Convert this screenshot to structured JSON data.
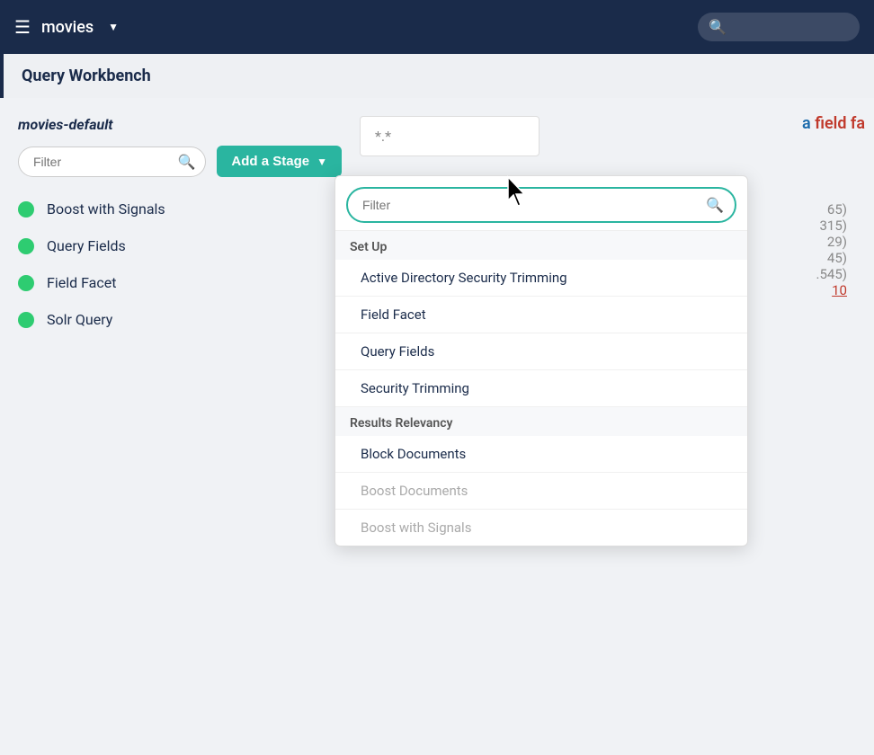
{
  "topbar": {
    "app_name": "movies",
    "search_placeholder": ""
  },
  "subheader": {
    "title": "Query Workbench"
  },
  "left": {
    "index_name": "movies-default",
    "filter_placeholder": "Filter",
    "add_stage_label": "Add a Stage",
    "stages": [
      {
        "id": 1,
        "label": "Boost with Signals",
        "active": true
      },
      {
        "id": 2,
        "label": "Query Fields",
        "active": true
      },
      {
        "id": 3,
        "label": "Field Facet",
        "active": true
      },
      {
        "id": 4,
        "label": "Solr Query",
        "active": true
      }
    ]
  },
  "right": {
    "query_value": "*.*",
    "field_fa_label": "a field fa"
  },
  "dropdown": {
    "filter_placeholder": "Filter",
    "sections": [
      {
        "id": "setup",
        "label": "Set Up",
        "items": [
          {
            "id": "active-directory",
            "label": "Active Directory Security Trimming",
            "disabled": false
          },
          {
            "id": "field-facet",
            "label": "Field Facet",
            "disabled": false
          },
          {
            "id": "query-fields",
            "label": "Query Fields",
            "disabled": false
          },
          {
            "id": "security-trimming",
            "label": "Security Trimming",
            "disabled": false
          }
        ]
      },
      {
        "id": "results-relevancy",
        "label": "Results Relevancy",
        "items": [
          {
            "id": "block-documents",
            "label": "Block Documents",
            "disabled": false
          },
          {
            "id": "boost-documents",
            "label": "Boost Documents",
            "disabled": true
          },
          {
            "id": "boost-with-signals",
            "label": "Boost with Signals",
            "disabled": true
          }
        ]
      }
    ]
  },
  "partial_results": {
    "items": [
      {
        "count": "65)"
      },
      {
        "count": "315)"
      },
      {
        "count": "29)"
      },
      {
        "count": "45)"
      },
      {
        "count": ".545)"
      },
      {
        "link": "10"
      }
    ]
  }
}
